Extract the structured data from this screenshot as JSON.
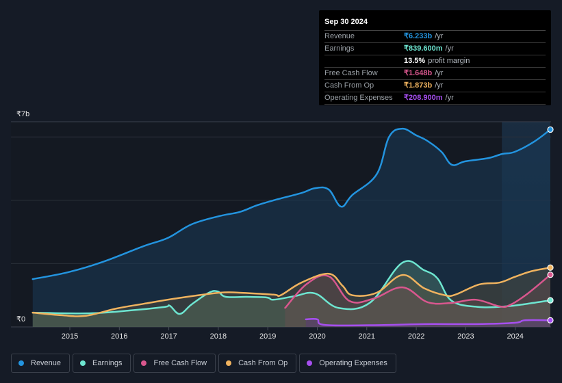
{
  "tooltip": {
    "date": "Sep 30 2024",
    "rows": [
      {
        "label": "Revenue",
        "value": "₹6.233b",
        "unit": "/yr",
        "color": "#2394df"
      },
      {
        "label": "Earnings",
        "value": "₹839.600m",
        "unit": "/yr",
        "color": "#6ee6d1"
      },
      {
        "label": "",
        "value": "13.5%",
        "unit": "profit margin",
        "color": "#ffffff"
      },
      {
        "label": "Free Cash Flow",
        "value": "₹1.648b",
        "unit": "/yr",
        "color": "#d9578e"
      },
      {
        "label": "Cash From Op",
        "value": "₹1.873b",
        "unit": "/yr",
        "color": "#f0b35f"
      },
      {
        "label": "Operating Expenses",
        "value": "₹208.900m",
        "unit": "/yr",
        "color": "#a64ff0"
      }
    ]
  },
  "legend": [
    {
      "label": "Revenue",
      "color": "#2394df"
    },
    {
      "label": "Earnings",
      "color": "#6ee6d1"
    },
    {
      "label": "Free Cash Flow",
      "color": "#d9578e"
    },
    {
      "label": "Cash From Op",
      "color": "#f0b35f"
    },
    {
      "label": "Operating Expenses",
      "color": "#a64ff0"
    }
  ],
  "chart_data": {
    "type": "area",
    "title": "",
    "xlabel": "",
    "ylabel": "",
    "y_tick_labels": [
      "₹0",
      "₹7b"
    ],
    "x_tick_labels": [
      "2015",
      "2016",
      "2017",
      "2018",
      "2019",
      "2020",
      "2021",
      "2022",
      "2023",
      "2024"
    ],
    "x_ticks": [
      2015,
      2016,
      2017,
      2018,
      2019,
      2020,
      2021,
      2022,
      2023,
      2024
    ],
    "xlim": [
      2014.0,
      2024.75
    ],
    "ylim": [
      0,
      6.48
    ],
    "gridlines_b": [
      2,
      4,
      6
    ],
    "highlight_from": 2023.73,
    "units": "INR billions",
    "series": [
      {
        "name": "Revenue",
        "color": "#2394df",
        "x": [
          2014.25,
          2014.97,
          2015.66,
          2016.49,
          2016.98,
          2017.46,
          2018.02,
          2018.43,
          2018.78,
          2019.12,
          2019.68,
          2019.95,
          2020.23,
          2020.48,
          2020.71,
          2021.2,
          2021.45,
          2021.72,
          2022.0,
          2022.23,
          2022.51,
          2022.72,
          2022.99,
          2023.45,
          2023.73,
          2023.99,
          2024.38,
          2024.71
        ],
        "values": [
          1.51,
          1.73,
          2.05,
          2.55,
          2.81,
          3.24,
          3.5,
          3.63,
          3.84,
          4.0,
          4.23,
          4.38,
          4.34,
          3.8,
          4.17,
          4.82,
          6.0,
          6.26,
          6.05,
          5.87,
          5.53,
          5.12,
          5.23,
          5.33,
          5.46,
          5.53,
          5.85,
          6.233
        ]
      },
      {
        "name": "Earnings",
        "color": "#6ee6d1",
        "x": [
          2014.25,
          2015.39,
          2016.22,
          2016.91,
          2017.02,
          2017.22,
          2017.46,
          2017.81,
          2017.99,
          2018.15,
          2018.57,
          2018.98,
          2019.12,
          2019.54,
          2019.95,
          2020.43,
          2021.06,
          2021.72,
          2022.16,
          2022.43,
          2022.72,
          2023.27,
          2023.82,
          2024.24,
          2024.71
        ],
        "values": [
          0.45,
          0.43,
          0.52,
          0.63,
          0.67,
          0.41,
          0.71,
          1.08,
          1.12,
          0.95,
          0.95,
          0.93,
          0.86,
          0.97,
          1.06,
          0.6,
          0.76,
          2.03,
          1.79,
          1.53,
          0.82,
          0.63,
          0.65,
          0.73,
          0.84
        ]
      },
      {
        "name": "Free Cash Flow",
        "color": "#d9578e",
        "x": [
          2019.35,
          2019.79,
          2020.23,
          2020.65,
          2021.13,
          2021.72,
          2022.23,
          2022.72,
          2023.2,
          2023.68,
          2023.89,
          2024.24,
          2024.71
        ],
        "values": [
          0.6,
          1.36,
          1.6,
          0.82,
          0.89,
          1.25,
          0.78,
          0.76,
          0.86,
          0.65,
          0.69,
          1.04,
          1.648
        ]
      },
      {
        "name": "Cash From Op",
        "color": "#f0b35f",
        "x": [
          2014.25,
          2014.83,
          2015.32,
          2015.94,
          2016.49,
          2017.19,
          2018.02,
          2018.43,
          2019.12,
          2019.26,
          2019.68,
          2020.23,
          2020.51,
          2020.71,
          2021.2,
          2021.72,
          2022.16,
          2022.58,
          2022.79,
          2023.27,
          2023.68,
          2023.99,
          2024.33,
          2024.71
        ],
        "values": [
          0.45,
          0.37,
          0.35,
          0.58,
          0.73,
          0.91,
          1.08,
          1.08,
          1.02,
          1.0,
          1.4,
          1.68,
          1.3,
          1.0,
          1.08,
          1.64,
          1.22,
          1.0,
          1.02,
          1.34,
          1.4,
          1.58,
          1.76,
          1.873
        ]
      },
      {
        "name": "Operating Expenses",
        "color": "#a64ff0",
        "x": [
          2019.77,
          2020.0,
          2020.17,
          2021.34,
          2022.16,
          2023.2,
          2023.99,
          2024.2,
          2024.71
        ],
        "values": [
          0.24,
          0.24,
          0.06,
          0.06,
          0.09,
          0.09,
          0.13,
          0.21,
          0.209
        ]
      }
    ]
  }
}
